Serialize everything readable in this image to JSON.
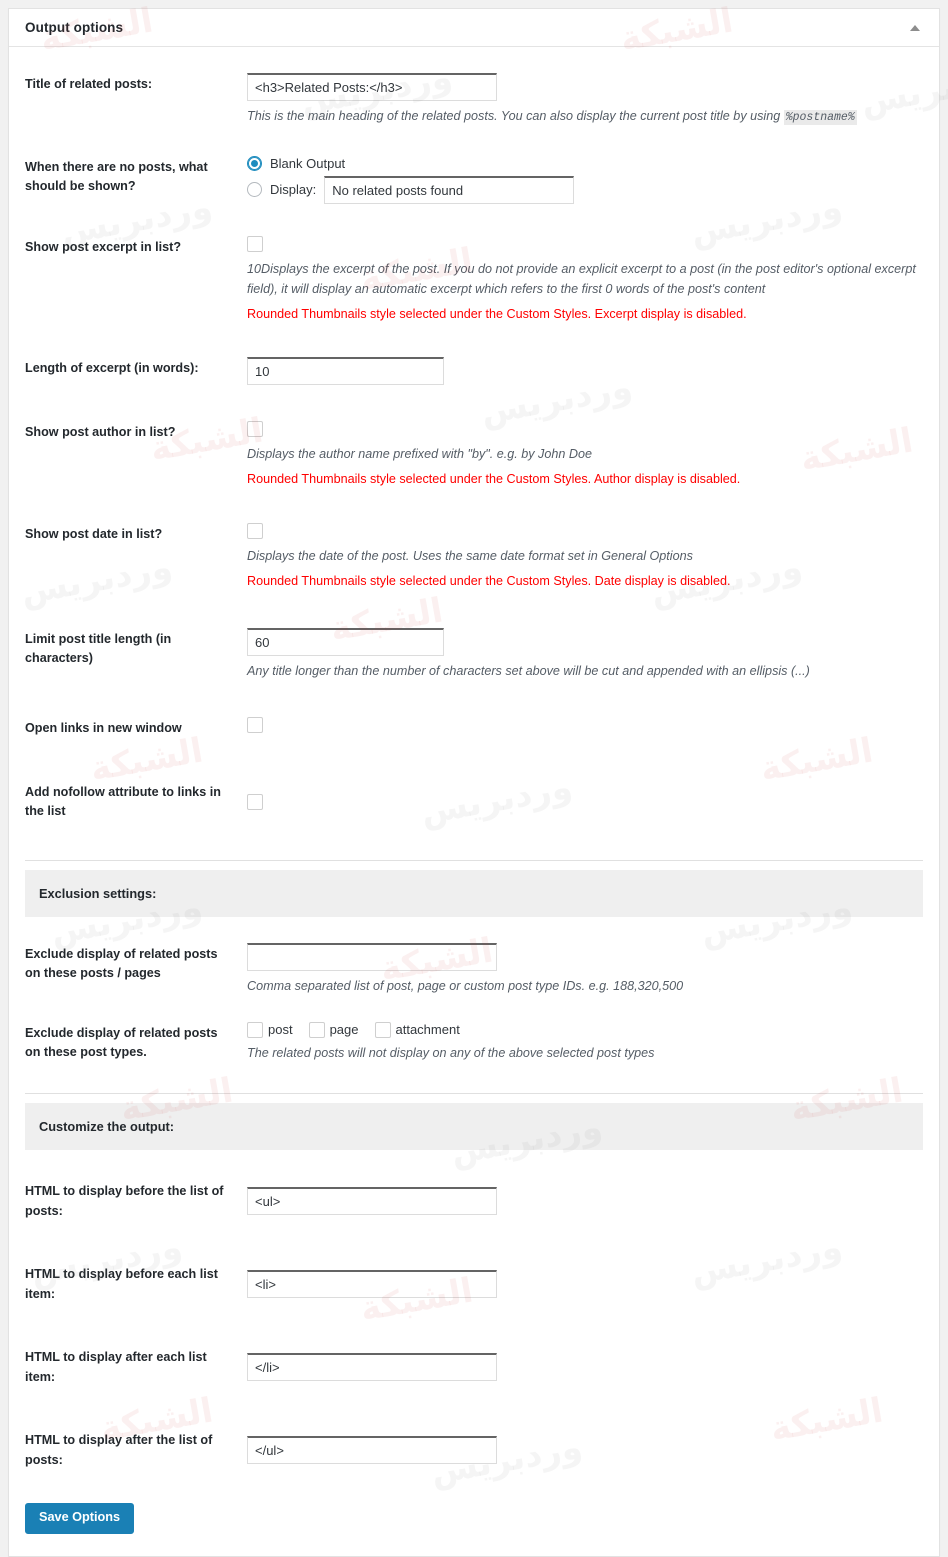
{
  "panel": {
    "title": "Output options",
    "toggle_icon": "triangle-up-icon"
  },
  "fields": {
    "title_related": {
      "label": "Title of related posts:",
      "value": "<h3>Related Posts:</h3>",
      "desc_before": "This is the main heading of the related posts. You can also display the current post title by using ",
      "desc_code": "%postname%"
    },
    "no_posts": {
      "label": "When there are no posts, what should be shown?",
      "option_blank": "Blank Output",
      "option_display": "Display:",
      "display_value": "No related posts found",
      "selected": "blank"
    },
    "show_excerpt": {
      "label": "Show post excerpt in list?",
      "checked": false,
      "desc": "10Displays the excerpt of the post. If you do not provide an explicit excerpt to a post (in the post editor's optional excerpt field), it will display an automatic excerpt which refers to the first 0 words of the post's content",
      "warn": "Rounded Thumbnails style selected under the Custom Styles. Excerpt display is disabled."
    },
    "excerpt_length": {
      "label": "Length of excerpt (in words):",
      "value": "10"
    },
    "show_author": {
      "label": "Show post author in list?",
      "checked": false,
      "desc": "Displays the author name prefixed with \"by\". e.g. by John Doe",
      "warn": "Rounded Thumbnails style selected under the Custom Styles. Author display is disabled."
    },
    "show_date": {
      "label": "Show post date in list?",
      "checked": false,
      "desc": "Displays the date of the post. Uses the same date format set in General Options",
      "warn": "Rounded Thumbnails style selected under the Custom Styles. Date display is disabled."
    },
    "title_length": {
      "label": "Limit post title length (in characters)",
      "value": "60",
      "desc": "Any title longer than the number of characters set above will be cut and appended with an ellipsis (...)"
    },
    "new_window": {
      "label": "Open links in new window",
      "checked": false
    },
    "nofollow": {
      "label": "Add nofollow attribute to links in the list",
      "checked": false
    }
  },
  "exclusion": {
    "section_title": "Exclusion settings:",
    "exclude_ids": {
      "label": "Exclude display of related posts on these posts / pages",
      "value": "",
      "desc": "Comma separated list of post, page or custom post type IDs. e.g. 188,320,500"
    },
    "exclude_types": {
      "label": "Exclude display of related posts on these post types.",
      "options": [
        {
          "name": "post",
          "checked": false
        },
        {
          "name": "page",
          "checked": false
        },
        {
          "name": "attachment",
          "checked": false
        }
      ],
      "desc": "The related posts will not display on any of the above selected post types"
    }
  },
  "customize": {
    "section_title": "Customize the output:",
    "before_list": {
      "label": "HTML to display before the list of posts:",
      "value": "<ul>"
    },
    "before_item": {
      "label": "HTML to display before each list item:",
      "value": "<li>"
    },
    "after_item": {
      "label": "HTML to display after each list item:",
      "value": "</li>"
    },
    "after_list": {
      "label": "HTML to display after the list of posts:",
      "value": "</ul>"
    }
  },
  "actions": {
    "save_label": "Save Options"
  },
  "colors": {
    "accent": "#1a80b5",
    "warning": "#ff0000",
    "radio_selected": "#1e8cbe",
    "section_bar": "#efefef"
  }
}
